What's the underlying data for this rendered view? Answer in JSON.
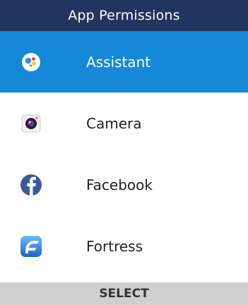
{
  "header": {
    "title": "App Permissions"
  },
  "apps": [
    {
      "label": "Assistant",
      "icon": "google-assistant-icon",
      "selected": true
    },
    {
      "label": "Camera",
      "icon": "camera-icon",
      "selected": false
    },
    {
      "label": "Facebook",
      "icon": "facebook-icon",
      "selected": false
    },
    {
      "label": "Fortress",
      "icon": "fortress-icon",
      "selected": false
    }
  ],
  "softkey": {
    "center": "SELECT"
  },
  "colors": {
    "header_bg": "#22355e",
    "selected_bg": "#1588d8",
    "softkey_bg": "#cfcfcf"
  }
}
